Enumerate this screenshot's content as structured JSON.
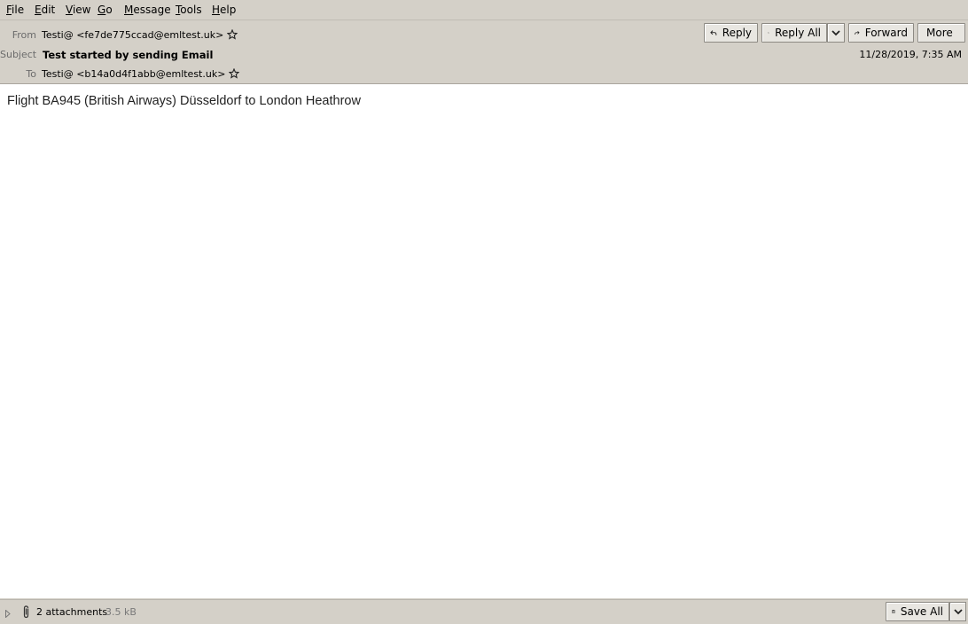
{
  "menu": {
    "items": [
      {
        "key": "F",
        "rest": "ile"
      },
      {
        "key": "E",
        "rest": "dit"
      },
      {
        "key": "V",
        "rest": "iew"
      },
      {
        "key": "G",
        "rest": "o"
      },
      {
        "key": "M",
        "rest": "essage"
      },
      {
        "key": "T",
        "rest": "ools"
      },
      {
        "key": "H",
        "rest": "elp"
      }
    ]
  },
  "header": {
    "from_label": "From",
    "from_value": "Testi@ <fe7de775ccad@emltest.uk>",
    "subject_label": "Subject",
    "subject_value": "Test started by sending Email",
    "to_label": "To",
    "to_value": "Testi@ <b14a0d4f1abb@emltest.uk>",
    "date": "11/28/2019, 7:35 AM",
    "buttons": {
      "reply": "Reply",
      "reply_all": "Reply All",
      "forward": "Forward",
      "more": "More"
    }
  },
  "body": {
    "text": "Flight BA945 (British Airways) Düsseldorf to London Heathrow"
  },
  "attachments": {
    "count_label": "2 attachments",
    "size": "3.5 kB",
    "save_all": "Save All"
  },
  "icons": [
    "star-icon",
    "reply-icon",
    "reply-all-icon",
    "forward-icon",
    "chevron-down-icon",
    "paperclip-icon",
    "disclosure-triangle-icon",
    "save-icon"
  ]
}
